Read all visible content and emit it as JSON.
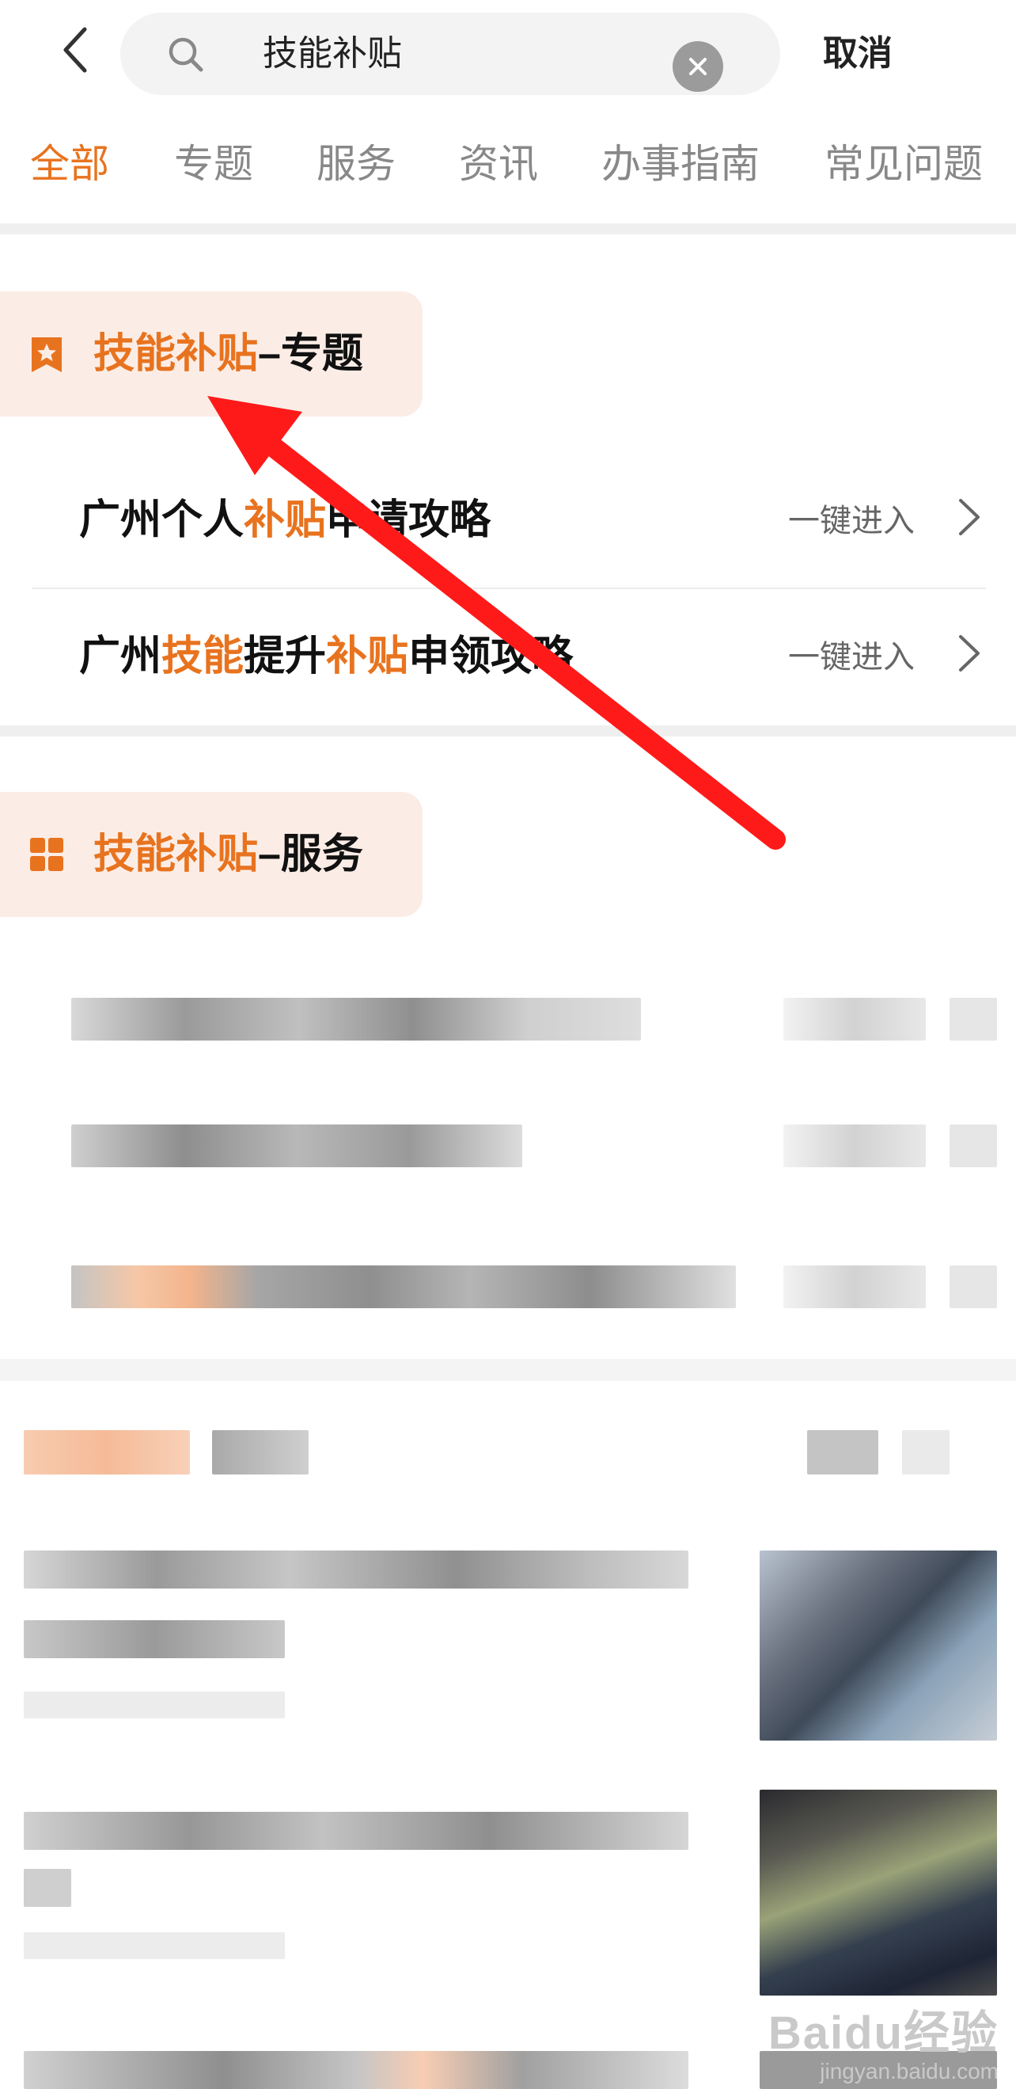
{
  "search": {
    "query": "技能补贴",
    "cancel_label": "取消"
  },
  "tabs": [
    {
      "label": "全部",
      "active": true
    },
    {
      "label": "专题",
      "active": false
    },
    {
      "label": "服务",
      "active": false
    },
    {
      "label": "资讯",
      "active": false
    },
    {
      "label": "办事指南",
      "active": false
    },
    {
      "label": "常见问题",
      "active": false
    }
  ],
  "topic_section": {
    "title_keyword": "技能补贴",
    "title_suffix": "–专题",
    "items": [
      {
        "title_parts": [
          "广州个人",
          "补贴",
          "申请攻略"
        ],
        "action": "一键进入"
      },
      {
        "title_parts": [
          "广州",
          "技能",
          "提升",
          "补贴",
          "申领攻略"
        ],
        "action": "一键进入"
      }
    ]
  },
  "service_section": {
    "title_keyword": "技能补贴",
    "title_suffix": "–服务"
  },
  "watermark": {
    "logo": "Baidu经验",
    "url": "jingyan.baidu.com"
  },
  "colors": {
    "accent": "#e8731f",
    "header_bg": "#fbede6",
    "annotation_arrow": "#ff1a1a"
  }
}
